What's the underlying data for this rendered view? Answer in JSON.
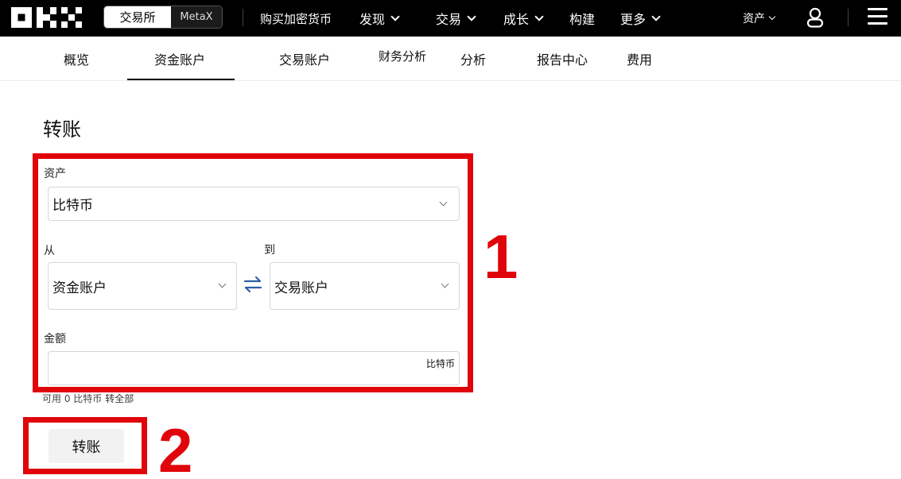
{
  "topbar": {
    "brand": "OKX",
    "segment": {
      "active": "交易所",
      "inactive": "MetaX"
    },
    "nav": [
      {
        "label": "购买加密货币",
        "has_dropdown": false
      },
      {
        "label": "发现",
        "has_dropdown": true
      },
      {
        "label": "交易",
        "has_dropdown": true
      },
      {
        "label": "成长",
        "has_dropdown": true
      },
      {
        "label": "构建",
        "has_dropdown": false
      },
      {
        "label": "更多",
        "has_dropdown": true
      }
    ],
    "assets": "资产",
    "icons": {
      "account": "user-icon",
      "menu": "hamburger-menu-icon"
    }
  },
  "subnav": {
    "tabs": [
      "概览",
      "资金账户",
      "交易账户",
      "财务分析",
      "分析",
      "报告中心",
      "费用"
    ],
    "active": "资金账户"
  },
  "transfer": {
    "title": "转账",
    "asset": {
      "label": "资产",
      "value": "比特币"
    },
    "from": {
      "label": "从",
      "value": "资金账户"
    },
    "to": {
      "label": "到",
      "value": "交易账户"
    },
    "amount": {
      "label": "金额",
      "value": "",
      "unit": "比特币"
    },
    "available": {
      "text": "可用 0 比特币",
      "action": "转全部"
    },
    "submit": "转账"
  },
  "annotations": {
    "box1": "1",
    "box2": "2",
    "color": "#e0050a"
  },
  "colors": {
    "topbar_bg": "#000000",
    "accent": "#000000",
    "annotation": "#e0050a"
  }
}
